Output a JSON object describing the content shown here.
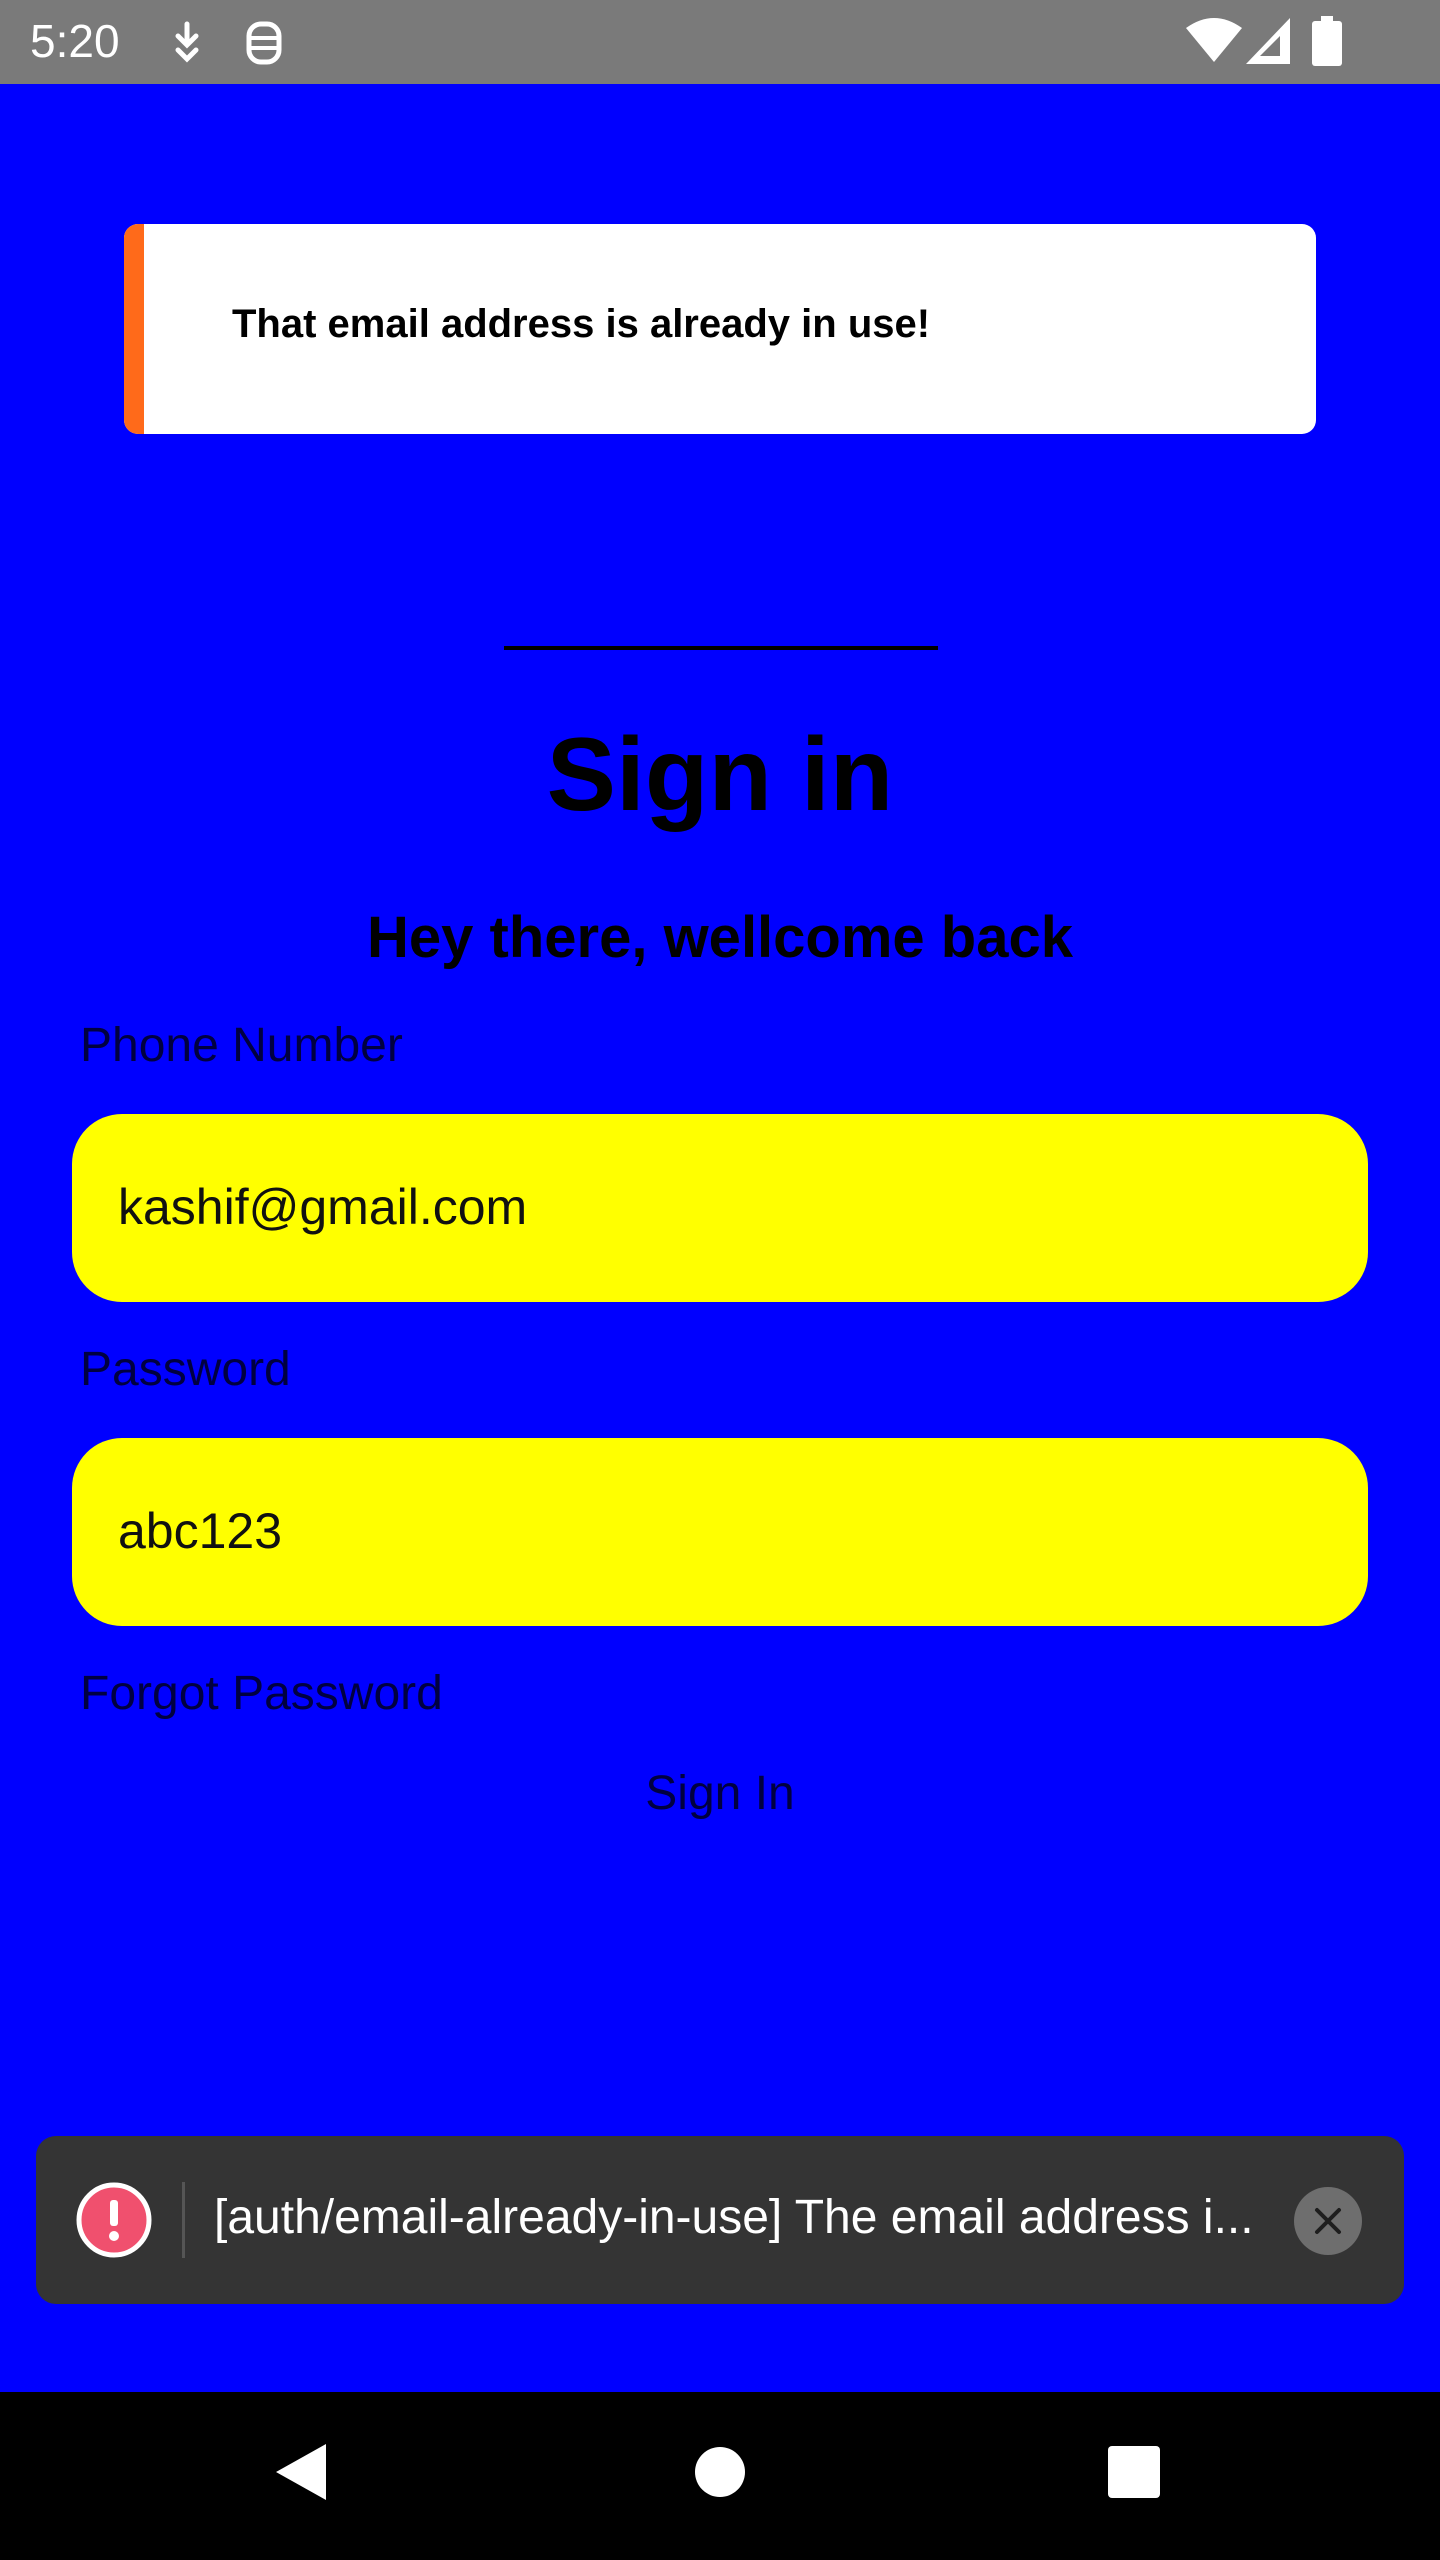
{
  "status_bar": {
    "time": "5:20",
    "left_icons": [
      "download-icon",
      "debug-icon"
    ],
    "right_icons": [
      "wifi-icon",
      "signal-icon",
      "battery-icon"
    ]
  },
  "toast": {
    "message": "That email address is already in use!",
    "accent_color": "#ff6a1a"
  },
  "header": {
    "title": "Sign in",
    "subtitle": "Hey there, wellcome back"
  },
  "form": {
    "phone_label": "Phone Number",
    "phone_value": "kashif@gmail.com",
    "password_label": "Password",
    "password_value": "abc123",
    "forgot_password": "Forgot Password",
    "sign_in_button": "Sign In"
  },
  "snackbar": {
    "message": "[auth/email-already-in-use] The email address i...",
    "icon": "error-icon",
    "close_icon": "close-icon"
  },
  "nav_bar": {
    "buttons": [
      "back-icon",
      "home-icon",
      "recents-icon"
    ]
  },
  "colors": {
    "background": "#0000ff",
    "field": "#ffff00",
    "status_bar": "#7a7a7a",
    "snackbar": "#343434",
    "error": "#f0506e"
  }
}
